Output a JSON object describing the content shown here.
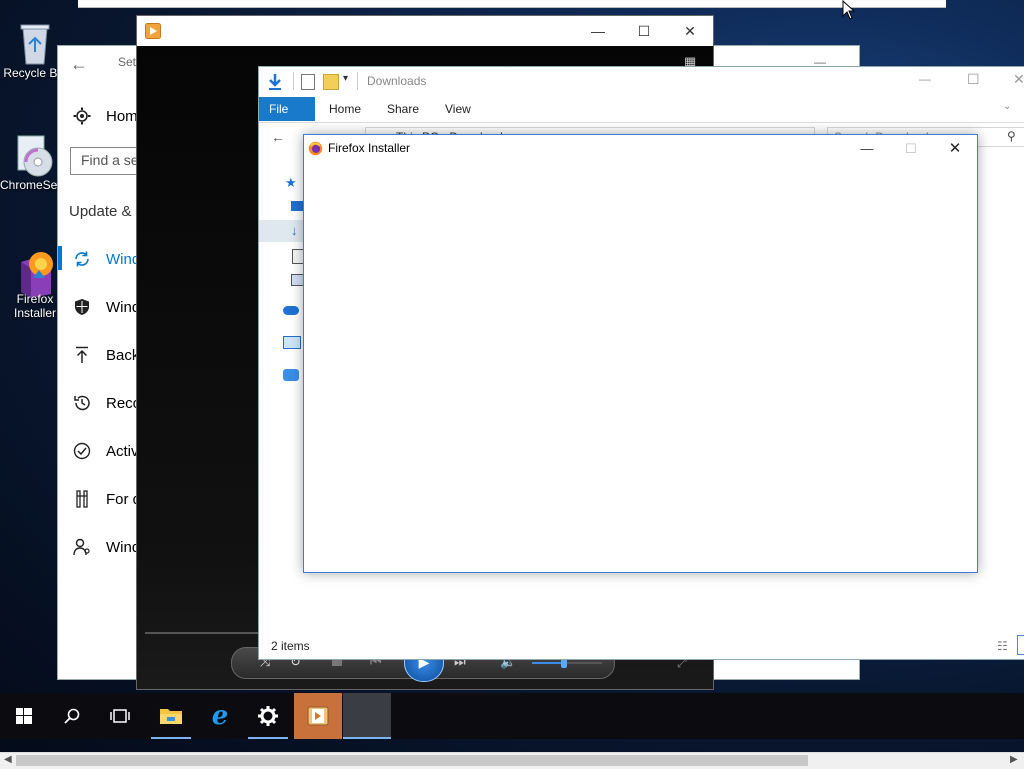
{
  "desktop": {
    "icons": [
      {
        "label": "Recycle Bin",
        "icon": "recycle-bin-icon"
      },
      {
        "label": "ChromeSetup",
        "icon": "setup-disc-icon"
      },
      {
        "label": "Firefox Installer",
        "icon": "firefox-installer-icon"
      }
    ]
  },
  "top_window": {
    "visible": "partial"
  },
  "settings": {
    "title": "Settings",
    "home_label": "Home",
    "search_placeholder": "Find a setting",
    "section_title": "Update & Security",
    "nav_items": [
      {
        "label": "Windows Update",
        "icon": "refresh-icon"
      },
      {
        "label": "Windows Security",
        "icon": "shield-icon"
      },
      {
        "label": "Backup",
        "icon": "backup-arrow-icon"
      },
      {
        "label": "Recovery",
        "icon": "history-icon"
      },
      {
        "label": "Activation",
        "icon": "check-circle-icon"
      },
      {
        "label": "For developers",
        "icon": "tools-icon"
      },
      {
        "label": "Windows Insider Program",
        "icon": "person-icon"
      }
    ]
  },
  "player": {
    "title": "",
    "controls": [
      "shuffle-icon",
      "repeat-icon",
      "stop-icon",
      "previous-icon",
      "play-icon",
      "next-icon",
      "volume-icon"
    ],
    "volume": 0.45
  },
  "explorer": {
    "title": "Downloads",
    "ribbon_tabs": [
      "File",
      "Home",
      "Share",
      "View"
    ],
    "breadcrumb": [
      "This PC",
      "Downloads"
    ],
    "search_placeholder": "Search Downloads",
    "status": "2 items"
  },
  "installer": {
    "title": "Firefox Installer"
  },
  "taskbar": {
    "buttons": [
      "start-icon",
      "search-icon",
      "task-view-icon",
      "file-explorer-icon",
      "internet-explorer-icon",
      "settings-gear-icon",
      "media-player-icon",
      "firefox-installer-task"
    ]
  },
  "colors": {
    "accent": "#0078d7",
    "taskbar_bg": "#0c0c10",
    "active_player_task": "#c9713a"
  }
}
